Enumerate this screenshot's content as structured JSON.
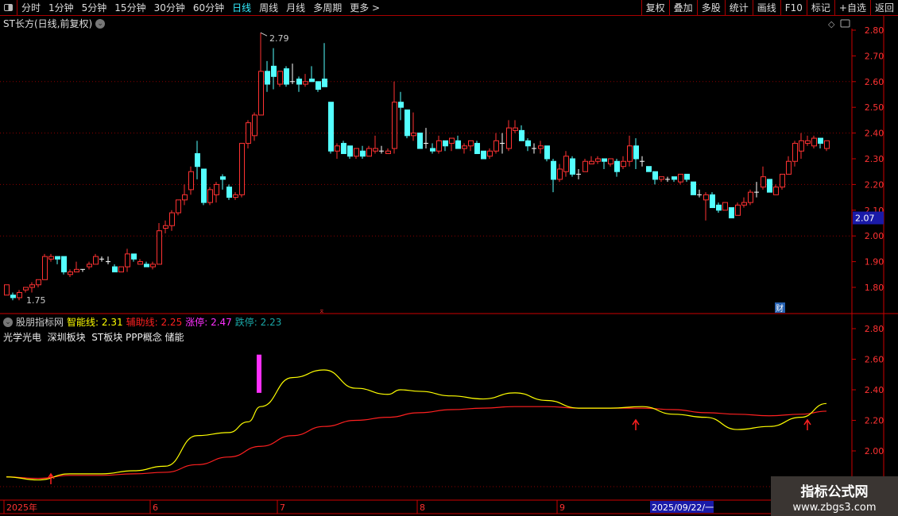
{
  "toolbar": {
    "periods": [
      "分时",
      "1分钟",
      "5分钟",
      "15分钟",
      "30分钟",
      "60分钟",
      "日线",
      "周线",
      "月线",
      "多周期",
      "更多 >"
    ],
    "active": "日线",
    "right_buttons": [
      "复权",
      "叠加",
      "多股",
      "统计",
      "画线",
      "F10",
      "标记",
      "+自选",
      "返回"
    ]
  },
  "chart": {
    "title": "ST长方(日线,前复权)",
    "high_label": "2.79",
    "low_label": "1.75",
    "current_price": "2.07",
    "fin_marker": "财",
    "price_axis": [
      "2.80",
      "2.70",
      "2.60",
      "2.50",
      "2.40",
      "2.30",
      "2.20",
      "2.10",
      "2.00",
      "1.90",
      "1.80"
    ],
    "colors": {
      "up": "#ff3232",
      "down": "#54ffff",
      "doji": "#ffffff",
      "grid": "#8b0000"
    },
    "candles": [
      [
        1.77,
        1.81,
        1.77,
        1.81
      ],
      [
        1.77,
        1.78,
        1.75,
        1.76
      ],
      [
        1.76,
        1.79,
        1.75,
        1.78
      ],
      [
        1.79,
        1.8,
        1.78,
        1.8
      ],
      [
        1.8,
        1.82,
        1.78,
        1.81
      ],
      [
        1.81,
        1.83,
        1.8,
        1.83
      ],
      [
        1.83,
        1.93,
        1.83,
        1.92
      ],
      [
        1.91,
        1.93,
        1.9,
        1.92
      ],
      [
        1.92,
        1.92,
        1.89,
        1.91
      ],
      [
        1.92,
        1.92,
        1.85,
        1.86
      ],
      [
        1.85,
        1.87,
        1.84,
        1.86
      ],
      [
        1.86,
        1.9,
        1.86,
        1.87
      ],
      [
        1.87,
        1.87,
        1.86,
        1.87
      ],
      [
        1.88,
        1.9,
        1.87,
        1.89
      ],
      [
        1.89,
        1.93,
        1.89,
        1.92
      ],
      [
        1.91,
        1.92,
        1.9,
        1.91
      ],
      [
        1.9,
        1.92,
        1.89,
        1.9
      ],
      [
        1.88,
        1.89,
        1.86,
        1.86
      ],
      [
        1.86,
        1.88,
        1.86,
        1.88
      ],
      [
        1.88,
        1.95,
        1.86,
        1.93
      ],
      [
        1.93,
        1.93,
        1.9,
        1.91
      ],
      [
        1.89,
        1.91,
        1.89,
        1.9
      ],
      [
        1.89,
        1.9,
        1.88,
        1.88
      ],
      [
        1.88,
        1.9,
        1.87,
        1.89
      ],
      [
        1.89,
        2.05,
        1.89,
        2.02
      ],
      [
        2.03,
        2.06,
        2.01,
        2.04
      ],
      [
        2.04,
        2.1,
        2.02,
        2.09
      ],
      [
        2.09,
        2.14,
        2.08,
        2.14
      ],
      [
        2.14,
        2.2,
        2.12,
        2.16
      ],
      [
        2.18,
        2.27,
        2.16,
        2.25
      ],
      [
        2.32,
        2.37,
        2.22,
        2.27
      ],
      [
        2.26,
        2.26,
        2.12,
        2.13
      ],
      [
        2.13,
        2.19,
        2.12,
        2.18
      ],
      [
        2.16,
        2.21,
        2.13,
        2.2
      ],
      [
        2.23,
        2.24,
        2.18,
        2.22
      ],
      [
        2.19,
        2.2,
        2.14,
        2.15
      ],
      [
        2.15,
        2.17,
        2.14,
        2.16
      ],
      [
        2.16,
        2.36,
        2.15,
        2.36
      ],
      [
        2.36,
        2.45,
        2.34,
        2.44
      ],
      [
        2.39,
        2.48,
        2.37,
        2.47
      ],
      [
        2.47,
        2.79,
        2.47,
        2.64
      ],
      [
        2.64,
        2.68,
        2.56,
        2.59
      ],
      [
        2.66,
        2.73,
        2.57,
        2.62
      ],
      [
        2.59,
        2.64,
        2.58,
        2.64
      ],
      [
        2.65,
        2.66,
        2.58,
        2.59
      ],
      [
        2.6,
        2.67,
        2.59,
        2.6
      ],
      [
        2.61,
        2.62,
        2.56,
        2.59
      ],
      [
        2.59,
        2.63,
        2.58,
        2.6
      ],
      [
        2.61,
        2.66,
        2.6,
        2.6
      ],
      [
        2.6,
        2.6,
        2.56,
        2.57
      ],
      [
        2.61,
        2.75,
        2.58,
        2.58
      ],
      [
        2.52,
        2.52,
        2.32,
        2.33
      ],
      [
        2.33,
        2.36,
        2.3,
        2.35
      ],
      [
        2.36,
        2.37,
        2.32,
        2.32
      ],
      [
        2.35,
        2.35,
        2.3,
        2.31
      ],
      [
        2.31,
        2.34,
        2.3,
        2.34
      ],
      [
        2.33,
        2.35,
        2.3,
        2.31
      ],
      [
        2.31,
        2.35,
        2.31,
        2.34
      ],
      [
        2.33,
        2.39,
        2.32,
        2.34
      ],
      [
        2.33,
        2.35,
        2.32,
        2.33
      ],
      [
        2.32,
        2.34,
        2.32,
        2.33
      ],
      [
        2.34,
        2.6,
        2.32,
        2.52
      ],
      [
        2.52,
        2.56,
        2.45,
        2.5
      ],
      [
        2.49,
        2.49,
        2.38,
        2.39
      ],
      [
        2.39,
        2.48,
        2.37,
        2.4
      ],
      [
        2.4,
        2.4,
        2.34,
        2.34
      ],
      [
        2.36,
        2.42,
        2.34,
        2.36
      ],
      [
        2.34,
        2.36,
        2.32,
        2.33
      ],
      [
        2.33,
        2.39,
        2.32,
        2.37
      ],
      [
        2.37,
        2.37,
        2.33,
        2.35
      ],
      [
        2.36,
        2.38,
        2.33,
        2.38
      ],
      [
        2.37,
        2.39,
        2.34,
        2.34
      ],
      [
        2.34,
        2.36,
        2.32,
        2.35
      ],
      [
        2.35,
        2.37,
        2.33,
        2.37
      ],
      [
        2.36,
        2.37,
        2.32,
        2.32
      ],
      [
        2.33,
        2.33,
        2.3,
        2.3
      ],
      [
        2.31,
        2.34,
        2.3,
        2.33
      ],
      [
        2.33,
        2.4,
        2.32,
        2.37
      ],
      [
        2.36,
        2.4,
        2.32,
        2.36
      ],
      [
        2.34,
        2.45,
        2.33,
        2.42
      ],
      [
        2.41,
        2.45,
        2.4,
        2.42
      ],
      [
        2.41,
        2.43,
        2.37,
        2.37
      ],
      [
        2.37,
        2.38,
        2.33,
        2.35
      ],
      [
        2.34,
        2.36,
        2.32,
        2.34
      ],
      [
        2.34,
        2.37,
        2.32,
        2.35
      ],
      [
        2.35,
        2.35,
        2.29,
        2.3
      ],
      [
        2.29,
        2.3,
        2.17,
        2.22
      ],
      [
        2.22,
        2.28,
        2.21,
        2.26
      ],
      [
        2.25,
        2.33,
        2.23,
        2.31
      ],
      [
        2.3,
        2.31,
        2.23,
        2.24
      ],
      [
        2.24,
        2.26,
        2.22,
        2.24
      ],
      [
        2.25,
        2.3,
        2.25,
        2.29
      ],
      [
        2.28,
        2.31,
        2.28,
        2.29
      ],
      [
        2.29,
        2.31,
        2.28,
        2.3
      ],
      [
        2.3,
        2.3,
        2.26,
        2.29
      ],
      [
        2.28,
        2.3,
        2.27,
        2.3
      ],
      [
        2.29,
        2.3,
        2.23,
        2.25
      ],
      [
        2.27,
        2.31,
        2.26,
        2.29
      ],
      [
        2.29,
        2.39,
        2.27,
        2.35
      ],
      [
        2.35,
        2.38,
        2.26,
        2.3
      ],
      [
        2.29,
        2.31,
        2.27,
        2.29
      ],
      [
        2.27,
        2.27,
        2.25,
        2.25
      ],
      [
        2.25,
        2.25,
        2.2,
        2.22
      ],
      [
        2.22,
        2.23,
        2.21,
        2.23
      ],
      [
        2.22,
        2.23,
        2.21,
        2.22
      ],
      [
        2.23,
        2.23,
        2.21,
        2.22
      ],
      [
        2.21,
        2.24,
        2.2,
        2.24
      ],
      [
        2.24,
        2.24,
        2.21,
        2.22
      ],
      [
        2.21,
        2.21,
        2.16,
        2.16
      ],
      [
        2.16,
        2.18,
        2.15,
        2.16
      ],
      [
        2.14,
        2.17,
        2.06,
        2.16
      ],
      [
        2.16,
        2.17,
        2.11,
        2.11
      ],
      [
        2.12,
        2.13,
        2.09,
        2.1
      ],
      [
        2.1,
        2.13,
        2.1,
        2.13
      ],
      [
        2.11,
        2.11,
        2.07,
        2.07
      ],
      [
        2.08,
        2.13,
        2.08,
        2.12
      ],
      [
        2.12,
        2.15,
        2.11,
        2.13
      ],
      [
        2.13,
        2.18,
        2.12,
        2.17
      ],
      [
        2.17,
        2.21,
        2.15,
        2.17
      ],
      [
        2.19,
        2.27,
        2.18,
        2.23
      ],
      [
        2.22,
        2.22,
        2.17,
        2.17
      ],
      [
        2.16,
        2.2,
        2.16,
        2.19
      ],
      [
        2.19,
        2.24,
        2.18,
        2.24
      ],
      [
        2.24,
        2.31,
        2.24,
        2.29
      ],
      [
        2.29,
        2.37,
        2.27,
        2.36
      ],
      [
        2.33,
        2.4,
        2.3,
        2.37
      ],
      [
        2.36,
        2.39,
        2.35,
        2.37
      ],
      [
        2.35,
        2.39,
        2.34,
        2.38
      ],
      [
        2.38,
        2.38,
        2.34,
        2.36
      ],
      [
        2.34,
        2.37,
        2.33,
        2.37
      ]
    ]
  },
  "indicator": {
    "name": "股朋指标网",
    "smart_line": {
      "label": "智能线:",
      "value": "2.31",
      "color": "#ffff00"
    },
    "aux_line": {
      "label": "辅助线:",
      "value": "2.25",
      "color": "#ff2020"
    },
    "limit_up": {
      "label": "涨停:",
      "value": "2.47",
      "color": "#ff30ff"
    },
    "limit_down": {
      "label": "跌停:",
      "value": "2.23",
      "color": "#1aa7a7"
    },
    "concepts": "光学光电  深圳板块  ST板块 PPP概念 储能",
    "axis": [
      "2.80",
      "2.60",
      "2.40",
      "2.20",
      "2.00"
    ],
    "smart_points": [
      [
        0,
        1.83
      ],
      [
        5,
        1.81
      ],
      [
        10,
        1.85
      ],
      [
        15,
        1.85
      ],
      [
        20,
        1.87
      ],
      [
        25,
        1.9
      ],
      [
        30,
        2.1
      ],
      [
        35,
        2.12
      ],
      [
        38,
        2.19
      ],
      [
        40,
        2.29
      ],
      [
        45,
        2.48
      ],
      [
        50,
        2.53
      ],
      [
        55,
        2.41
      ],
      [
        60,
        2.37
      ],
      [
        62,
        2.4
      ],
      [
        65,
        2.39
      ],
      [
        70,
        2.36
      ],
      [
        75,
        2.34
      ],
      [
        80,
        2.38
      ],
      [
        85,
        2.33
      ],
      [
        90,
        2.28
      ],
      [
        95,
        2.28
      ],
      [
        100,
        2.29
      ],
      [
        105,
        2.24
      ],
      [
        110,
        2.22
      ],
      [
        115,
        2.14
      ],
      [
        120,
        2.16
      ],
      [
        125,
        2.22
      ],
      [
        129,
        2.31
      ]
    ],
    "aux_points": [
      [
        0,
        1.83
      ],
      [
        5,
        1.82
      ],
      [
        10,
        1.84
      ],
      [
        15,
        1.84
      ],
      [
        20,
        1.85
      ],
      [
        25,
        1.86
      ],
      [
        30,
        1.91
      ],
      [
        35,
        1.96
      ],
      [
        40,
        2.03
      ],
      [
        45,
        2.1
      ],
      [
        50,
        2.16
      ],
      [
        55,
        2.2
      ],
      [
        60,
        2.22
      ],
      [
        65,
        2.25
      ],
      [
        70,
        2.27
      ],
      [
        75,
        2.28
      ],
      [
        80,
        2.29
      ],
      [
        85,
        2.29
      ],
      [
        90,
        2.28
      ],
      [
        95,
        2.28
      ],
      [
        100,
        2.28
      ],
      [
        105,
        2.27
      ],
      [
        110,
        2.25
      ],
      [
        115,
        2.24
      ],
      [
        120,
        2.23
      ],
      [
        125,
        2.24
      ],
      [
        129,
        2.26
      ]
    ],
    "signal_bar": {
      "index": 40,
      "from": 2.38,
      "to": 2.63
    },
    "arrows": [
      7,
      99,
      126
    ]
  },
  "date_axis": {
    "labels": [
      {
        "text": "2025年",
        "index": 0
      },
      {
        "text": "6",
        "index": 23
      },
      {
        "text": "7",
        "index": 43
      },
      {
        "text": "8",
        "index": 65
      },
      {
        "text": "9",
        "index": 87
      }
    ],
    "cursor_date": "2025/09/22/一"
  },
  "watermark": {
    "title": "指标公式网",
    "url": "www.zbgs3.com"
  }
}
